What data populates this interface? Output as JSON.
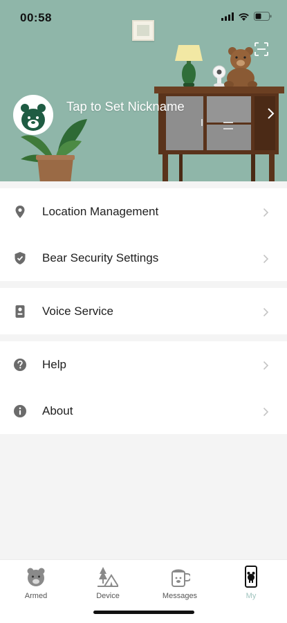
{
  "status_bar": {
    "time": "00:58",
    "icons": [
      "cellular-signal-icon",
      "wifi-icon",
      "battery-icon"
    ]
  },
  "header": {
    "nickname_prompt": "Tap to Set Nickname",
    "background_color": "#8fb6a9",
    "icons": [
      "scan-icon",
      "bear-avatar-icon",
      "chevron-right-icon"
    ]
  },
  "menu": {
    "groups": [
      {
        "items": [
          {
            "label": "Location Management",
            "icon": "location-pin-icon"
          },
          {
            "label": "Bear Security Settings",
            "icon": "shield-check-icon"
          }
        ]
      },
      {
        "items": [
          {
            "label": "Voice Service",
            "icon": "voice-speaker-icon"
          }
        ]
      },
      {
        "items": [
          {
            "label": "Help",
            "icon": "help-icon"
          },
          {
            "label": "About",
            "icon": "info-icon"
          }
        ]
      }
    ]
  },
  "tabbar": {
    "tabs": [
      {
        "label": "Armed",
        "icon": "bear-face-icon",
        "active": false
      },
      {
        "label": "Device",
        "icon": "tent-trees-icon",
        "active": false
      },
      {
        "label": "Messages",
        "icon": "mug-bear-icon",
        "active": false
      },
      {
        "label": "My",
        "icon": "phone-bear-icon",
        "active": true
      }
    ],
    "active_color": "#9fc3bd"
  }
}
